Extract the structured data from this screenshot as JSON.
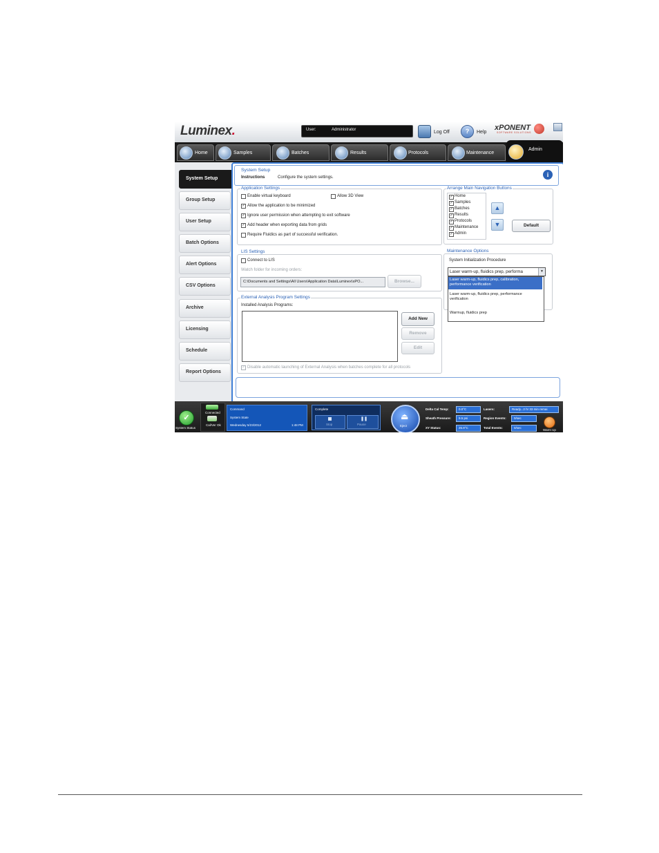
{
  "header": {
    "logo": "Luminex",
    "user_label": "User:",
    "user_value": "Administrator",
    "logoff_label": "Log Off",
    "help_label": "Help",
    "brand": "xPONENT",
    "brand_sub": "SOFTWARE SOLUTIONS"
  },
  "nav": {
    "tabs": [
      {
        "label": "Home"
      },
      {
        "label": "Samples"
      },
      {
        "label": "Batches"
      },
      {
        "label": "Results"
      },
      {
        "label": "Protocols"
      },
      {
        "label": "Maintenance"
      },
      {
        "label": "Admin"
      }
    ]
  },
  "sidebar": {
    "items": [
      {
        "label": "System Setup"
      },
      {
        "label": "Group Setup"
      },
      {
        "label": "User Setup"
      },
      {
        "label": "Batch Options"
      },
      {
        "label": "Alert Options"
      },
      {
        "label": "CSV Options"
      },
      {
        "label": "Archive"
      },
      {
        "label": "Licensing"
      },
      {
        "label": "Schedule"
      },
      {
        "label": "Report Options"
      }
    ]
  },
  "page": {
    "title": "System Setup",
    "instructions_label": "Instructions",
    "instructions_text": "Configure the system settings."
  },
  "app_settings": {
    "title": "Application Settings",
    "options": [
      {
        "label": "Enable virtual keyboard",
        "checked": false
      },
      {
        "label": "Allow 3D View",
        "checked": false
      },
      {
        "label": "Allow the application to be minimized",
        "checked": true
      },
      {
        "label": "Ignore user permission when attempting to exit software",
        "checked": true
      },
      {
        "label": "Add header when exporting data from grids",
        "checked": true
      },
      {
        "label": "Require Fluidics as part of successful verification.",
        "checked": false
      }
    ]
  },
  "nav_buttons": {
    "title": "Arrange Main Navigation Buttons",
    "items": [
      "Home",
      "Samples",
      "Batches",
      "Results",
      "Protocols",
      "Maintenance",
      "Admin"
    ],
    "default_label": "Default"
  },
  "lis": {
    "title": "LIS Settings",
    "connect_label": "Connect to LIS",
    "watch_label": "Watch folder for incoming orders:",
    "path_value": "C:\\Documents and Settings\\All Users\\Application Data\\Luminex\\xPO...",
    "browse_label": "Browse..."
  },
  "external": {
    "title": "External Analysis Program Settings",
    "installed_label": "Installed Analysis Programs:",
    "add_label": "Add New",
    "remove_label": "Remove",
    "edit_label": "Edit",
    "disable_label": "Disable automatic launching of External Analysis when batches complete for all protocols"
  },
  "maintenance": {
    "title": "Maintenance Options",
    "proc_label": "System Initialization Procedure",
    "selected": "Laser warm-up, fluidics prep, performa",
    "options": [
      {
        "line1": "Laser warm-up, fluidics prep, calibration,",
        "line2": "performance verification"
      },
      {
        "line1": "Laser warm-up, fluidics prep, performance",
        "line2": "verification"
      },
      {
        "line1": "Warmup, fluidics prep",
        "line2": ""
      }
    ]
  },
  "statusbar": {
    "system_status": "System Status",
    "connected": "Connected",
    "calver": "Cal/Ver Ok",
    "command": "Command",
    "system_state": "System State",
    "date": "Wednesday 5/23/2012",
    "time": "1:48 PM",
    "complete": "Complete",
    "stop": "Stop",
    "pause": "Pause",
    "eject": "Eject",
    "delta_label": "Delta Cal Temp:",
    "delta_value": "0.0°C",
    "sheath_label": "Sheath Pressure:",
    "sheath_value": "9.5 psi",
    "xy_label": "XY Status:",
    "xy_value": "25.9°C",
    "lasers_label": "Lasers:",
    "lasers_value": "Ready...2 hr 33 min remai",
    "region_label": "Region Events:",
    "region_value": "0/sec",
    "total_label": "Total Events:",
    "total_value": "0/sec",
    "warmup": "Warm Up"
  }
}
